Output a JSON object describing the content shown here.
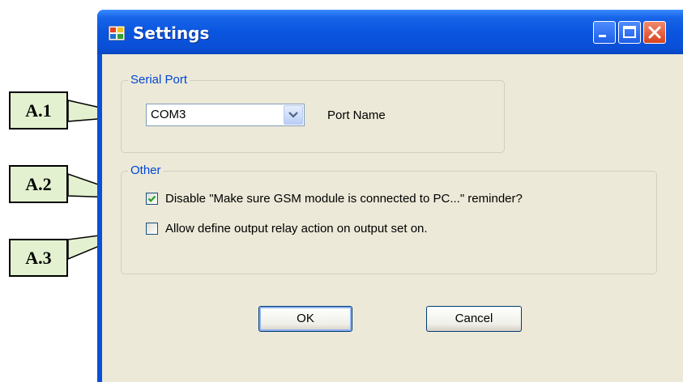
{
  "window": {
    "title": "Settings",
    "icons": [
      "app-icon",
      "minimize-icon",
      "maximize-icon",
      "close-icon"
    ]
  },
  "serial_port": {
    "group_label": "Serial Port",
    "port_value": "COM3",
    "port_label": "Port Name"
  },
  "other": {
    "group_label": "Other",
    "checkboxes": [
      {
        "label": "Disable  \"Make sure GSM module is connected to PC...\" reminder?",
        "checked": true
      },
      {
        "label": "Allow define output relay action on output set on.",
        "checked": false
      }
    ]
  },
  "buttons": {
    "ok": "OK",
    "cancel": "Cancel"
  },
  "callouts": [
    "A.1",
    "A.2",
    "A.3"
  ],
  "colors": {
    "titlebar": "#0a4fd6",
    "client": "#ece9d8",
    "group_label": "#0046d5",
    "callout_fill": "#e4f1d0"
  }
}
